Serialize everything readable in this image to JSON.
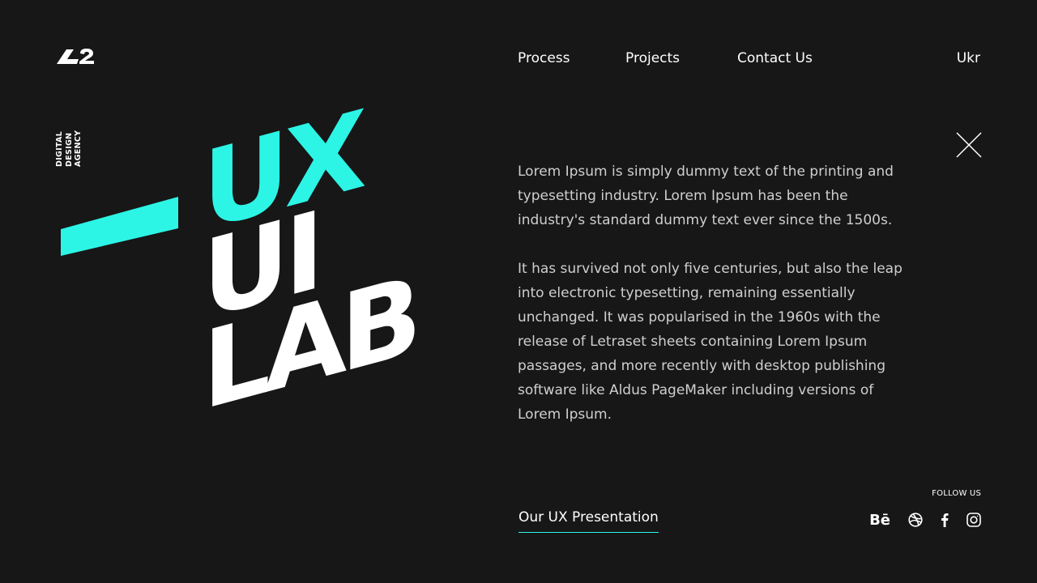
{
  "header": {
    "logo_icon": "l2-logo-icon",
    "nav": [
      "Process",
      "Projects",
      "Contact Us"
    ],
    "lang": "Ukr",
    "close_icon": "close-icon"
  },
  "hero": {
    "tagline": [
      "DIGITAL",
      "DESIGN",
      "AGENCY"
    ],
    "line1": "UX",
    "line2": "UI",
    "line3": "LAB",
    "accent_color": "#2cf5e6",
    "text_color": "#ffffff"
  },
  "content": {
    "paragraphs": [
      "Lorem Ipsum is simply dummy text of the printing and typesetting industry. Lorem Ipsum has been the industry's standard dummy text ever since the 1500s.",
      "It has survived not only five centuries, but also the leap into electronic typesetting, remaining essentially unchanged. It was popularised in the 1960s with the release of Letraset sheets containing Lorem Ipsum passages, and more recently with desktop publishing software like Aldus PageMaker including versions of Lorem Ipsum."
    ]
  },
  "footer": {
    "presentation_link": "Our UX Presentation",
    "follow_label": "FOLLOW US",
    "social": {
      "behance": "Bē",
      "icons": [
        "behance-icon",
        "dribbble-icon",
        "facebook-icon",
        "instagram-icon"
      ]
    }
  },
  "colors": {
    "background": "#171717",
    "accent": "#2cf5e6",
    "body_text": "#cfcfcf"
  }
}
